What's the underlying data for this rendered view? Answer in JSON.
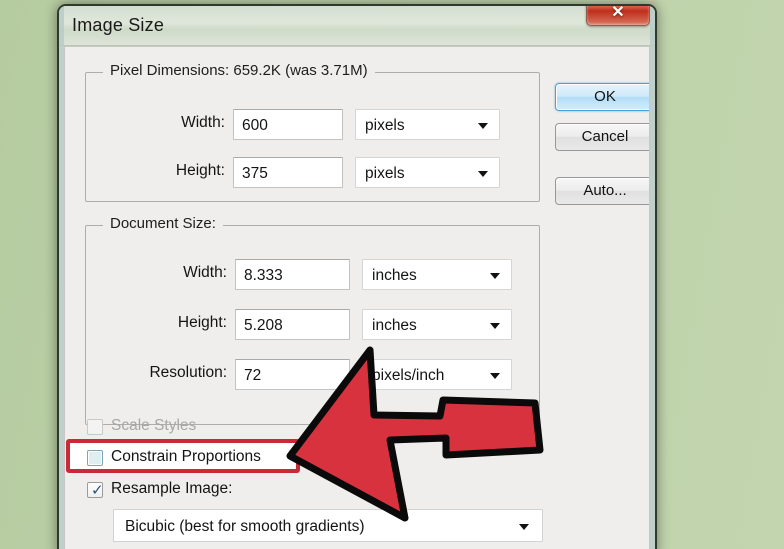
{
  "window": {
    "title": "Image Size",
    "close_icon": "close-icon",
    "close_glyph": "✕"
  },
  "pixel_dimensions": {
    "group_title": "Pixel Dimensions:  659.2K (was 3.71M)",
    "width_label": "Width:",
    "width_value": "600",
    "width_unit": "pixels",
    "height_label": "Height:",
    "height_value": "375",
    "height_unit": "pixels"
  },
  "document_size": {
    "group_title": "Document Size:",
    "width_label": "Width:",
    "width_value": "8.333",
    "width_unit": "inches",
    "height_label": "Height:",
    "height_value": "5.208",
    "height_unit": "inches",
    "resolution_label": "Resolution:",
    "resolution_value": "72",
    "resolution_unit": "pixels/inch"
  },
  "options": {
    "scale_styles_label": "Scale Styles",
    "scale_styles_checked": false,
    "scale_styles_enabled": false,
    "constrain_proportions_label": "Constrain Proportions",
    "constrain_proportions_checked": false,
    "resample_image_label": "Resample Image:",
    "resample_image_checked": true,
    "resample_check_glyph": "✓",
    "resample_method": "Bicubic (best for smooth gradients)"
  },
  "buttons": {
    "ok_label": "OK",
    "cancel_label": "Cancel",
    "auto_label": "Auto..."
  },
  "annotation": {
    "arrow_name": "red-arrow-pointer",
    "arrow_fill": "#d9323f",
    "arrow_stroke": "#0a0a0a",
    "highlight_color": "#cc2936"
  },
  "colors": {
    "desktop_background": "#bcd1a8",
    "dialog_background": "#efeeed",
    "accent_ok": "#b3dcf7"
  }
}
